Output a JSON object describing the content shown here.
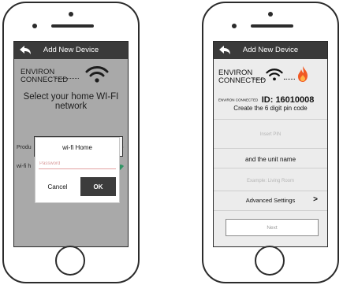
{
  "app": {
    "title": "Add New Device",
    "brand_line1": "ENVIRON",
    "brand_line2": "CONNECTED"
  },
  "left": {
    "instruction": "Select your home WI-FI network",
    "networks": [
      {
        "label": "Produ"
      },
      {
        "label": "wi-fi h"
      }
    ],
    "dialog": {
      "title": "wi-fi Home",
      "password_placeholder": "Password",
      "cancel_label": "Cancel",
      "ok_label": "OK"
    }
  },
  "right": {
    "id_small": "ENVIRON CONNECTED",
    "id_big": "ID: 16010008",
    "pin_title": "Create the 6 digit pin code",
    "pin_placeholder": "Insert PIN",
    "unit_title": "and the unit name",
    "unit_placeholder": "Example: Living Room",
    "advanced_label": "Advanced Settings",
    "advanced_chevron": ">",
    "next_label": "Next"
  },
  "colors": {
    "topbar": "#3a3a3a",
    "ok_button": "#3c3c3c",
    "wifi_green": "#2bb673",
    "fire_orange": "#f15a24"
  }
}
